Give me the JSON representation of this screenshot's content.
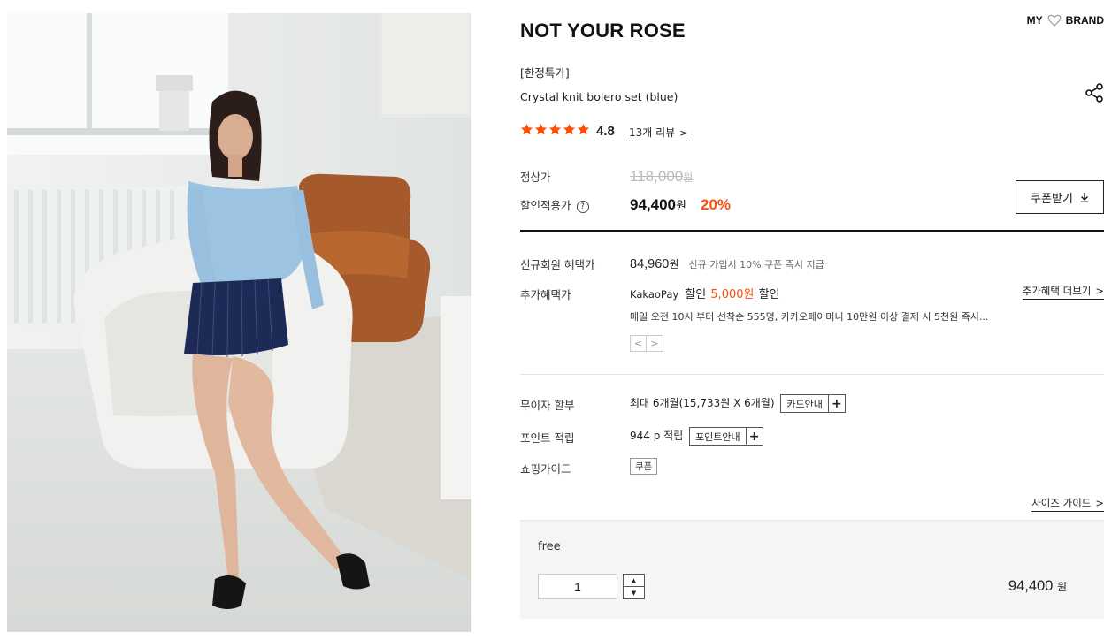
{
  "product": {
    "brand": "NOT YOUR ROSE",
    "tag": "[한정특가]",
    "name": "Crystal knit bolero set (blue)",
    "rating": "4.8",
    "stars": 5,
    "reviews_label": "13개 리뷰",
    "image_alt": "model wearing blue knit bolero set"
  },
  "header": {
    "my_label": "MY",
    "brand_label": "BRAND"
  },
  "icons": {
    "wishlist": "heart-icon",
    "share": "share-icon",
    "download": "download-icon"
  },
  "price": {
    "regular_label": "정상가",
    "regular_value": "118,000",
    "regular_unit": "원",
    "sale_label": "할인적용가",
    "help": "?",
    "sale_value": "94,400",
    "sale_unit": "원",
    "sale_rate": "20%",
    "coupon_button": "쿠폰받기"
  },
  "benefits": {
    "new_member_label": "신규회원 혜택가",
    "new_member_value": "84,960",
    "new_member_unit": "원",
    "new_member_note": "신규 가입시 10% 쿠폰 즉시 지급",
    "extra_label": "추가혜택가",
    "extra_more": "추가혜택 더보기",
    "kakao_name": "KakaoPay",
    "kakao_pre": "할인",
    "kakao_amount": "5,000원",
    "kakao_post": "할인",
    "kakao_desc": "매일 오전 10시 부터 선착순 555명, 카카오페이머니 10만원 이상 결제 시 5천원 즉시..."
  },
  "payment": {
    "installment_label": "무이자 할부",
    "installment_value": "최대 6개월(15,733원 X 6개월)",
    "card_info": "카드안내",
    "points_label": "포인트 적립",
    "points_value": "944 p 적립",
    "points_info": "포인트안내",
    "shopping_label": "쇼핑가이드",
    "shopping_chip": "쿠폰",
    "size_guide": "사이즈 가이드"
  },
  "option": {
    "name": "free",
    "quantity": "1",
    "price": "94,400",
    "unit": "원"
  },
  "colors": {
    "accent": "#ff4d0d",
    "text": "#222222",
    "muted": "#bbbbbb",
    "option_bg": "#f5f5f5"
  }
}
